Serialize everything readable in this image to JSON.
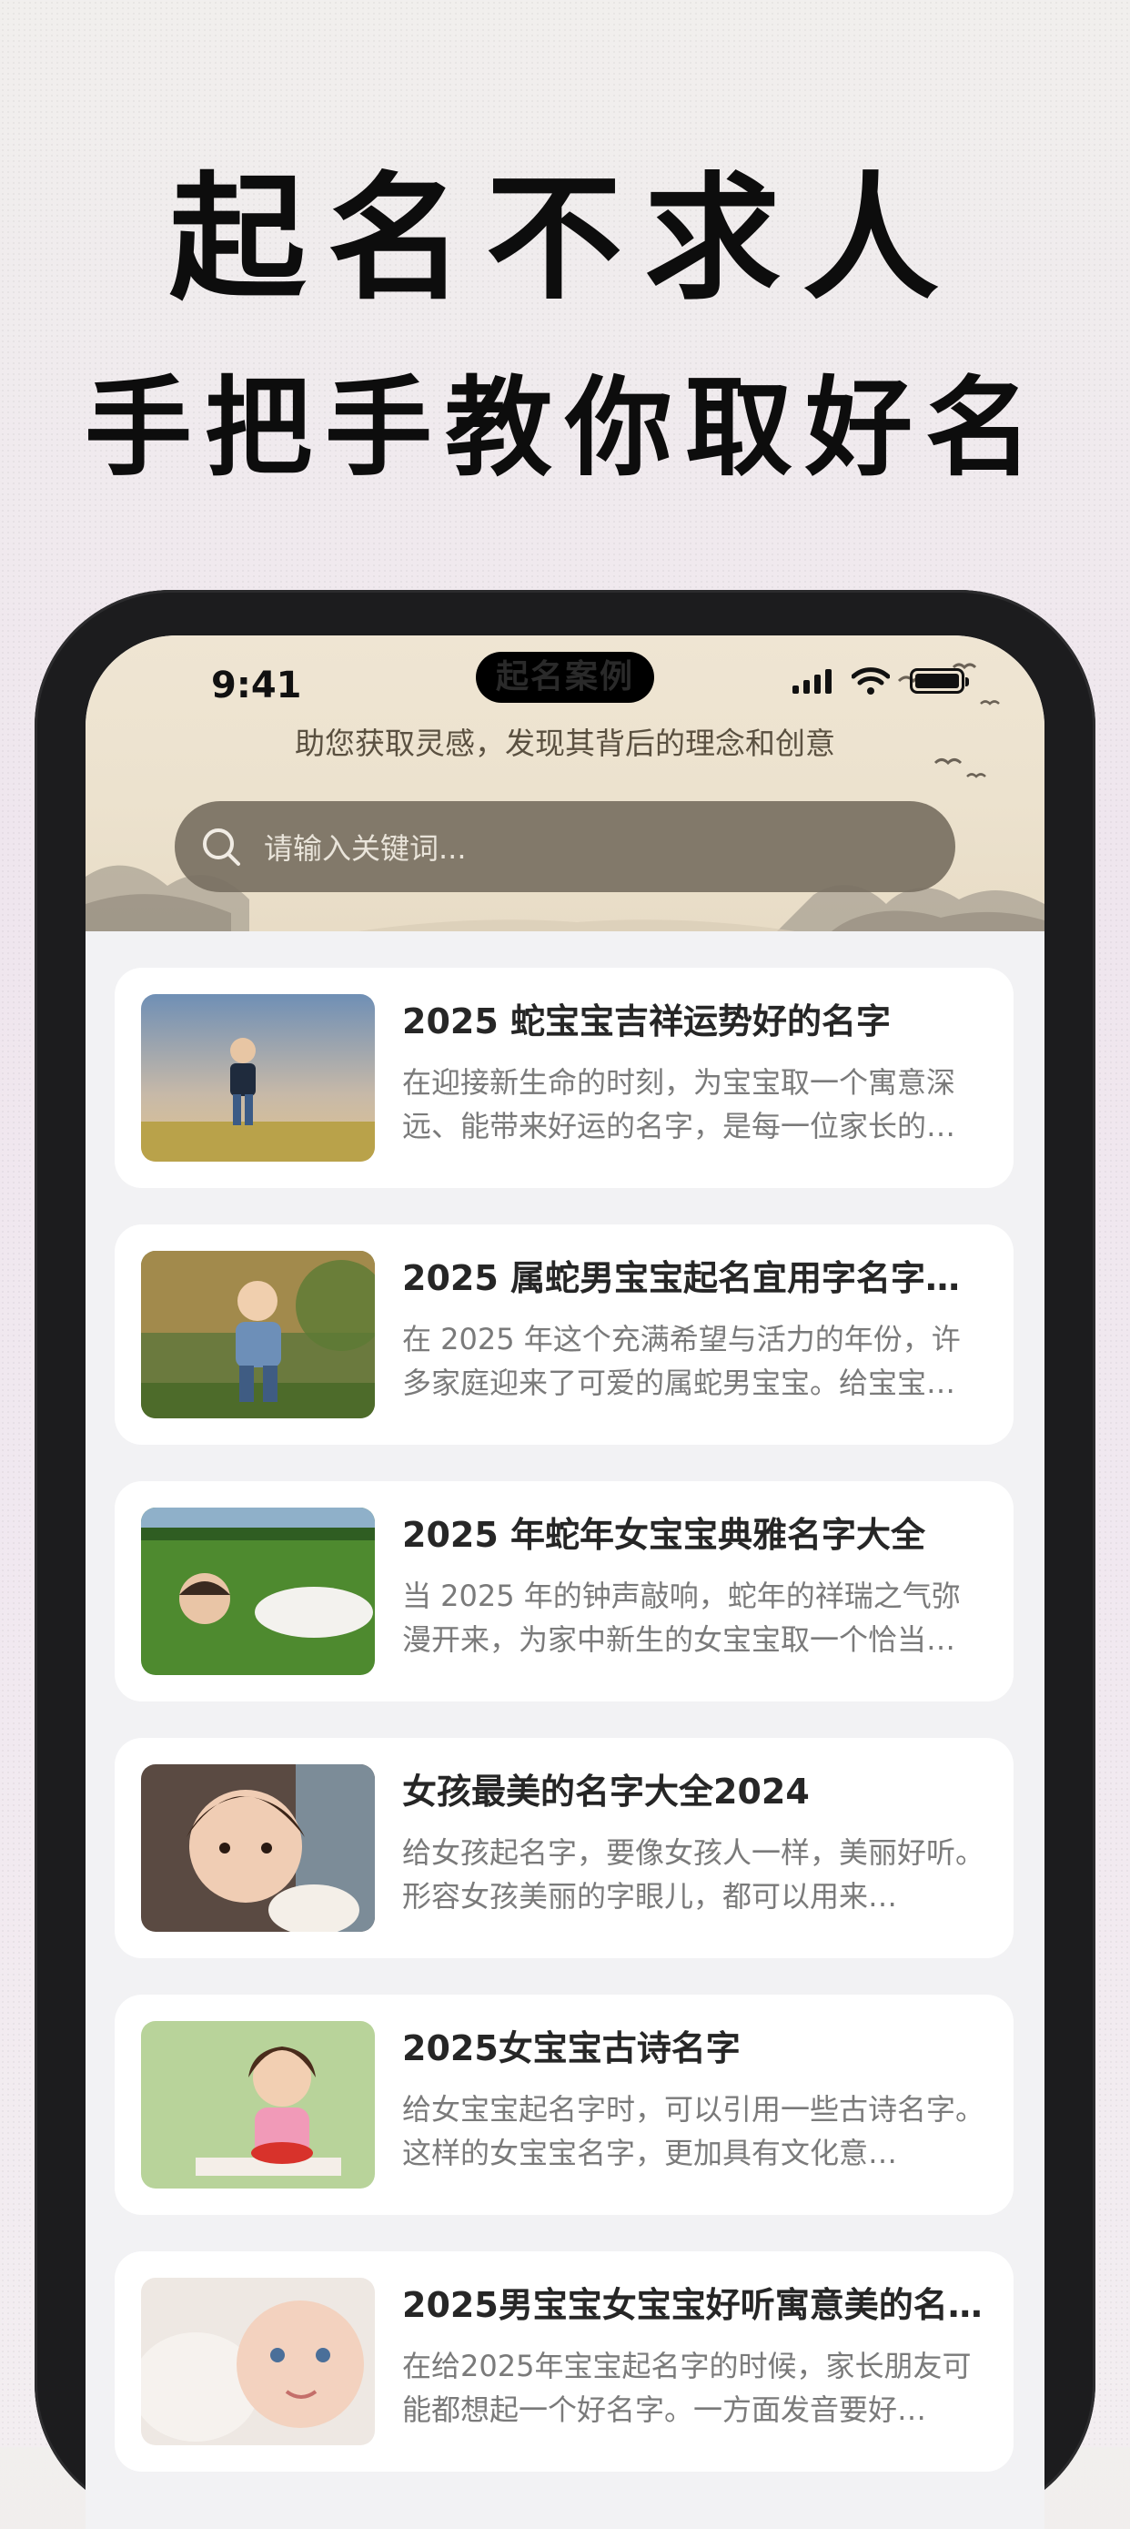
{
  "promo": {
    "headline": "起名不求人",
    "subheadline": "手把手教你取好名"
  },
  "status_bar": {
    "time": "9:41",
    "app_title": "起名案例",
    "battery_level": 1.0
  },
  "header": {
    "subtitle": "助您获取灵感，发现其背后的理念和创意"
  },
  "search": {
    "placeholder": "请输入关键词..."
  },
  "articles": [
    {
      "title": "2025 蛇宝宝吉祥运势好的名字",
      "desc": "在迎接新生命的时刻，为宝宝取一个寓意深远、能带来好运的名字，是每一位家长的…",
      "image": "toddler-in-field"
    },
    {
      "title": "2025 属蛇男宝宝起名宜用字名字…",
      "desc": "在 2025 年这个充满希望与活力的年份，许多家庭迎来了可爱的属蛇男宝宝。给宝宝…",
      "image": "baby-boy-walking"
    },
    {
      "title": "2025 年蛇年女宝宝典雅名字大全",
      "desc": "当 2025 年的钟声敲响，蛇年的祥瑞之气弥漫开来，为家中新生的女宝宝取一个恰当…",
      "image": "baby-on-grass"
    },
    {
      "title": "女孩最美的名字大全2024",
      "desc": "给女孩起名字，要像女孩人一样，美丽好听。形容女孩美丽的字眼儿，都可以用来…",
      "image": "baby-girl-with-puppy"
    },
    {
      "title": "2025女宝宝古诗名字",
      "desc": "给女宝宝起名字时，可以引用一些古诗名字。这样的女宝宝名字，更加具有文化意…",
      "image": "girl-with-strawberries"
    },
    {
      "title": "2025男宝宝女宝宝好听寓意美的名…",
      "desc": "在给2025年宝宝起名字的时候，家长朋友可能都想起一个好名字。一方面发音要好…",
      "image": "smiling-infant"
    }
  ]
}
